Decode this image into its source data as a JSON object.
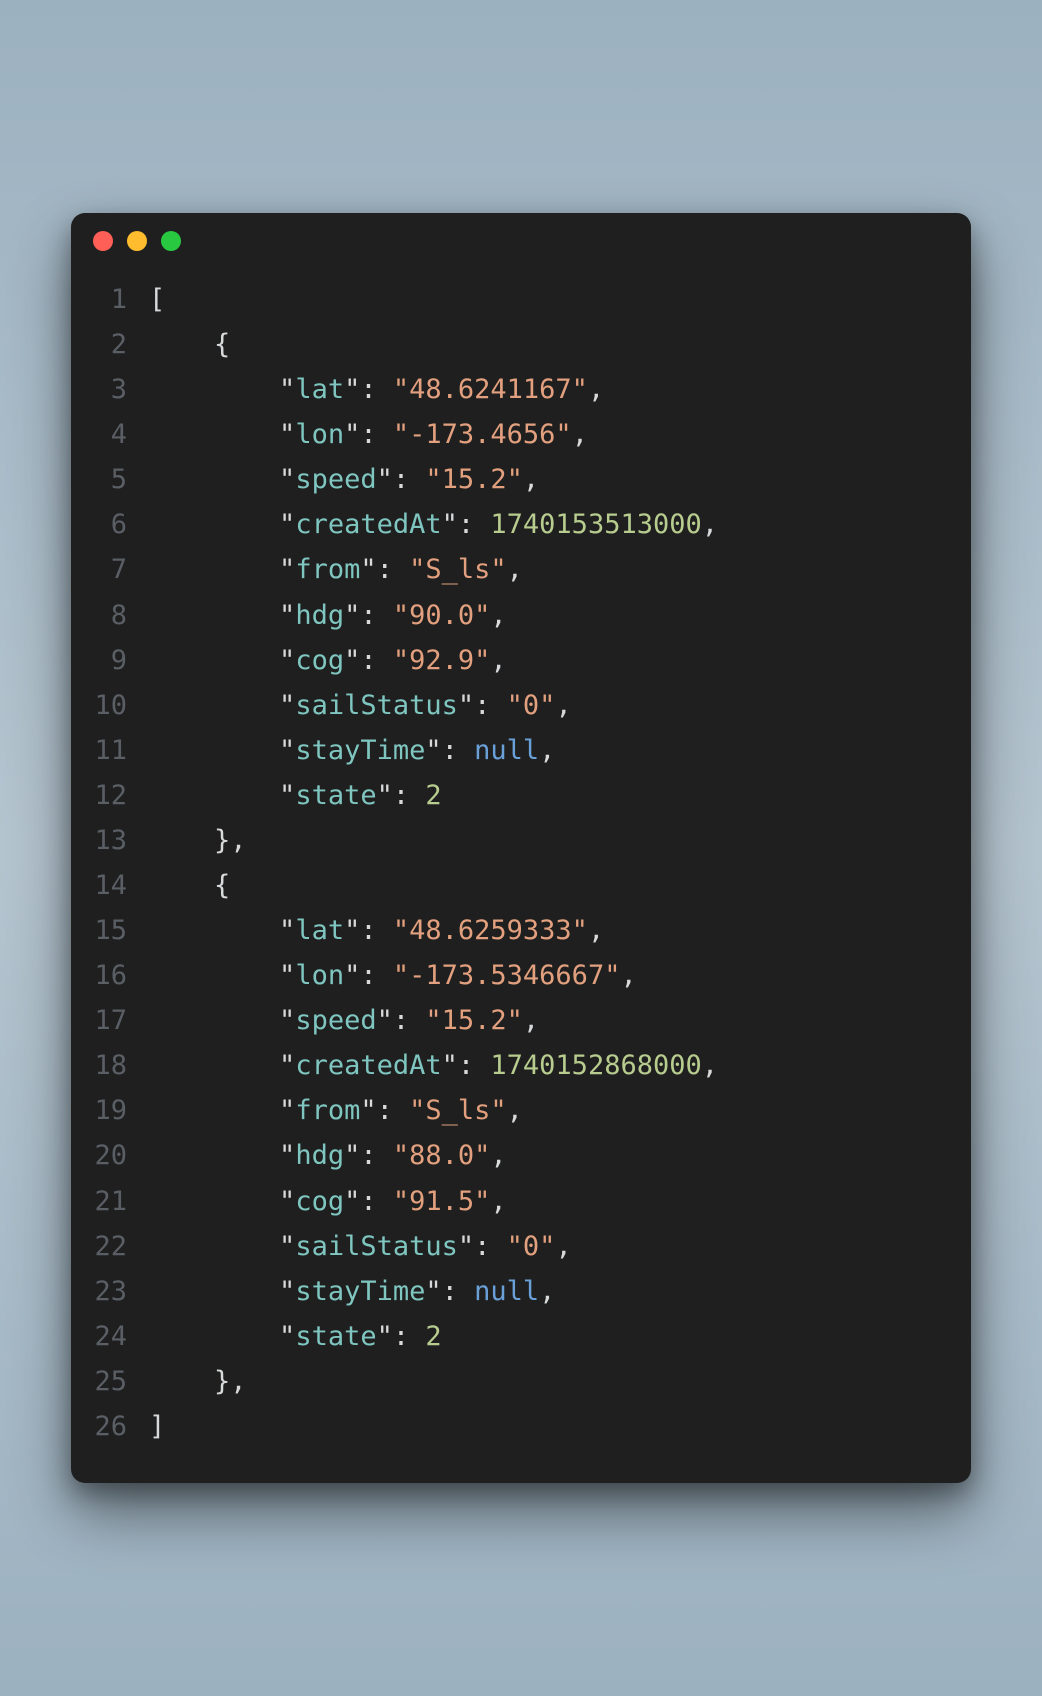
{
  "window": {
    "traffic": {
      "red": "close",
      "yellow": "minimize",
      "green": "zoom"
    }
  },
  "indent": "    ",
  "lines": [
    {
      "n": 1,
      "depth": 0,
      "tokens": [
        {
          "t": "p",
          "v": "["
        }
      ]
    },
    {
      "n": 2,
      "depth": 1,
      "tokens": [
        {
          "t": "p",
          "v": "{"
        }
      ]
    },
    {
      "n": 3,
      "depth": 2,
      "tokens": [
        {
          "t": "p",
          "v": "\""
        },
        {
          "t": "k",
          "v": "lat"
        },
        {
          "t": "p",
          "v": "\""
        },
        {
          "t": "p",
          "v": ": "
        },
        {
          "t": "s",
          "v": "\"48.6241167\""
        },
        {
          "t": "p",
          "v": ","
        }
      ]
    },
    {
      "n": 4,
      "depth": 2,
      "tokens": [
        {
          "t": "p",
          "v": "\""
        },
        {
          "t": "k",
          "v": "lon"
        },
        {
          "t": "p",
          "v": "\""
        },
        {
          "t": "p",
          "v": ": "
        },
        {
          "t": "s",
          "v": "\"-173.4656\""
        },
        {
          "t": "p",
          "v": ","
        }
      ]
    },
    {
      "n": 5,
      "depth": 2,
      "tokens": [
        {
          "t": "p",
          "v": "\""
        },
        {
          "t": "k",
          "v": "speed"
        },
        {
          "t": "p",
          "v": "\""
        },
        {
          "t": "p",
          "v": ": "
        },
        {
          "t": "s",
          "v": "\"15.2\""
        },
        {
          "t": "p",
          "v": ","
        }
      ]
    },
    {
      "n": 6,
      "depth": 2,
      "tokens": [
        {
          "t": "p",
          "v": "\""
        },
        {
          "t": "k",
          "v": "createdAt"
        },
        {
          "t": "p",
          "v": "\""
        },
        {
          "t": "p",
          "v": ": "
        },
        {
          "t": "n",
          "v": "1740153513000"
        },
        {
          "t": "p",
          "v": ","
        }
      ]
    },
    {
      "n": 7,
      "depth": 2,
      "tokens": [
        {
          "t": "p",
          "v": "\""
        },
        {
          "t": "k",
          "v": "from"
        },
        {
          "t": "p",
          "v": "\""
        },
        {
          "t": "p",
          "v": ": "
        },
        {
          "t": "s",
          "v": "\"S_ls\""
        },
        {
          "t": "p",
          "v": ","
        }
      ]
    },
    {
      "n": 8,
      "depth": 2,
      "tokens": [
        {
          "t": "p",
          "v": "\""
        },
        {
          "t": "k",
          "v": "hdg"
        },
        {
          "t": "p",
          "v": "\""
        },
        {
          "t": "p",
          "v": ": "
        },
        {
          "t": "s",
          "v": "\"90.0\""
        },
        {
          "t": "p",
          "v": ","
        }
      ]
    },
    {
      "n": 9,
      "depth": 2,
      "tokens": [
        {
          "t": "p",
          "v": "\""
        },
        {
          "t": "k",
          "v": "cog"
        },
        {
          "t": "p",
          "v": "\""
        },
        {
          "t": "p",
          "v": ": "
        },
        {
          "t": "s",
          "v": "\"92.9\""
        },
        {
          "t": "p",
          "v": ","
        }
      ]
    },
    {
      "n": 10,
      "depth": 2,
      "tokens": [
        {
          "t": "p",
          "v": "\""
        },
        {
          "t": "k",
          "v": "sailStatus"
        },
        {
          "t": "p",
          "v": "\""
        },
        {
          "t": "p",
          "v": ": "
        },
        {
          "t": "s",
          "v": "\"0\""
        },
        {
          "t": "p",
          "v": ","
        }
      ]
    },
    {
      "n": 11,
      "depth": 2,
      "tokens": [
        {
          "t": "p",
          "v": "\""
        },
        {
          "t": "k",
          "v": "stayTime"
        },
        {
          "t": "p",
          "v": "\""
        },
        {
          "t": "p",
          "v": ": "
        },
        {
          "t": "nl",
          "v": "null"
        },
        {
          "t": "p",
          "v": ","
        }
      ]
    },
    {
      "n": 12,
      "depth": 2,
      "tokens": [
        {
          "t": "p",
          "v": "\""
        },
        {
          "t": "k",
          "v": "state"
        },
        {
          "t": "p",
          "v": "\""
        },
        {
          "t": "p",
          "v": ": "
        },
        {
          "t": "n",
          "v": "2"
        }
      ]
    },
    {
      "n": 13,
      "depth": 1,
      "tokens": [
        {
          "t": "p",
          "v": "},"
        }
      ]
    },
    {
      "n": 14,
      "depth": 1,
      "tokens": [
        {
          "t": "p",
          "v": "{"
        }
      ]
    },
    {
      "n": 15,
      "depth": 2,
      "tokens": [
        {
          "t": "p",
          "v": "\""
        },
        {
          "t": "k",
          "v": "lat"
        },
        {
          "t": "p",
          "v": "\""
        },
        {
          "t": "p",
          "v": ": "
        },
        {
          "t": "s",
          "v": "\"48.6259333\""
        },
        {
          "t": "p",
          "v": ","
        }
      ]
    },
    {
      "n": 16,
      "depth": 2,
      "tokens": [
        {
          "t": "p",
          "v": "\""
        },
        {
          "t": "k",
          "v": "lon"
        },
        {
          "t": "p",
          "v": "\""
        },
        {
          "t": "p",
          "v": ": "
        },
        {
          "t": "s",
          "v": "\"-173.5346667\""
        },
        {
          "t": "p",
          "v": ","
        }
      ]
    },
    {
      "n": 17,
      "depth": 2,
      "tokens": [
        {
          "t": "p",
          "v": "\""
        },
        {
          "t": "k",
          "v": "speed"
        },
        {
          "t": "p",
          "v": "\""
        },
        {
          "t": "p",
          "v": ": "
        },
        {
          "t": "s",
          "v": "\"15.2\""
        },
        {
          "t": "p",
          "v": ","
        }
      ]
    },
    {
      "n": 18,
      "depth": 2,
      "tokens": [
        {
          "t": "p",
          "v": "\""
        },
        {
          "t": "k",
          "v": "createdAt"
        },
        {
          "t": "p",
          "v": "\""
        },
        {
          "t": "p",
          "v": ": "
        },
        {
          "t": "n",
          "v": "1740152868000"
        },
        {
          "t": "p",
          "v": ","
        }
      ]
    },
    {
      "n": 19,
      "depth": 2,
      "tokens": [
        {
          "t": "p",
          "v": "\""
        },
        {
          "t": "k",
          "v": "from"
        },
        {
          "t": "p",
          "v": "\""
        },
        {
          "t": "p",
          "v": ": "
        },
        {
          "t": "s",
          "v": "\"S_ls\""
        },
        {
          "t": "p",
          "v": ","
        }
      ]
    },
    {
      "n": 20,
      "depth": 2,
      "tokens": [
        {
          "t": "p",
          "v": "\""
        },
        {
          "t": "k",
          "v": "hdg"
        },
        {
          "t": "p",
          "v": "\""
        },
        {
          "t": "p",
          "v": ": "
        },
        {
          "t": "s",
          "v": "\"88.0\""
        },
        {
          "t": "p",
          "v": ","
        }
      ]
    },
    {
      "n": 21,
      "depth": 2,
      "tokens": [
        {
          "t": "p",
          "v": "\""
        },
        {
          "t": "k",
          "v": "cog"
        },
        {
          "t": "p",
          "v": "\""
        },
        {
          "t": "p",
          "v": ": "
        },
        {
          "t": "s",
          "v": "\"91.5\""
        },
        {
          "t": "p",
          "v": ","
        }
      ]
    },
    {
      "n": 22,
      "depth": 2,
      "tokens": [
        {
          "t": "p",
          "v": "\""
        },
        {
          "t": "k",
          "v": "sailStatus"
        },
        {
          "t": "p",
          "v": "\""
        },
        {
          "t": "p",
          "v": ": "
        },
        {
          "t": "s",
          "v": "\"0\""
        },
        {
          "t": "p",
          "v": ","
        }
      ]
    },
    {
      "n": 23,
      "depth": 2,
      "tokens": [
        {
          "t": "p",
          "v": "\""
        },
        {
          "t": "k",
          "v": "stayTime"
        },
        {
          "t": "p",
          "v": "\""
        },
        {
          "t": "p",
          "v": ": "
        },
        {
          "t": "nl",
          "v": "null"
        },
        {
          "t": "p",
          "v": ","
        }
      ]
    },
    {
      "n": 24,
      "depth": 2,
      "tokens": [
        {
          "t": "p",
          "v": "\""
        },
        {
          "t": "k",
          "v": "state"
        },
        {
          "t": "p",
          "v": "\""
        },
        {
          "t": "p",
          "v": ": "
        },
        {
          "t": "n",
          "v": "2"
        }
      ]
    },
    {
      "n": 25,
      "depth": 1,
      "tokens": [
        {
          "t": "p",
          "v": "},"
        }
      ]
    },
    {
      "n": 26,
      "depth": 0,
      "tokens": [
        {
          "t": "p",
          "v": "]"
        }
      ]
    }
  ]
}
